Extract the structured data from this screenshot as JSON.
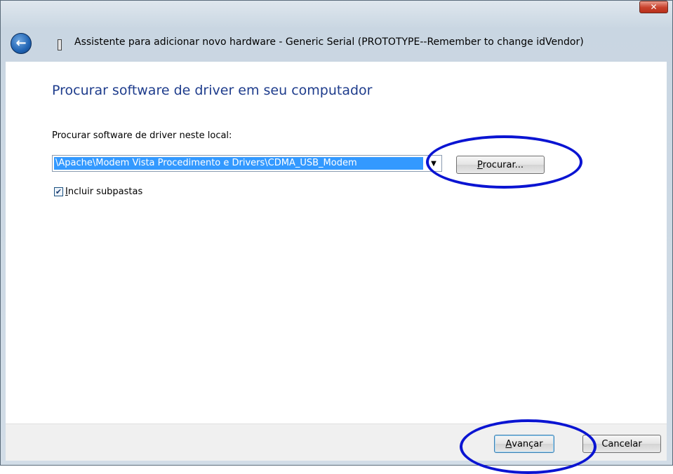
{
  "window": {
    "title": "Assistente para adicionar novo hardware - Generic Serial (PROTOTYPE--Remember to change idVendor)",
    "close_glyph": "✕"
  },
  "header": {
    "back_glyph": "←"
  },
  "main": {
    "heading": "Procurar software de driver em seu computador",
    "path_label": "Procurar software de driver neste local:",
    "path_value": "\\Apache\\Modem Vista Procedimento e Drivers\\CDMA_USB_Modem",
    "dropdown_glyph": "▼",
    "browse_button": {
      "accesskey": "P",
      "rest": "rocurar..."
    },
    "include_subfolders": {
      "checked": true,
      "check_glyph": "✔",
      "accesskey": "I",
      "rest": "ncluir subpastas"
    }
  },
  "footer": {
    "next_button": {
      "accesskey": "A",
      "rest": "vançar"
    },
    "cancel_button": "Cancelar"
  },
  "annotations": {
    "ellipse_color": "#0a14d2"
  },
  "colors": {
    "heading": "#1e3c8c",
    "selection": "#3399ff"
  }
}
